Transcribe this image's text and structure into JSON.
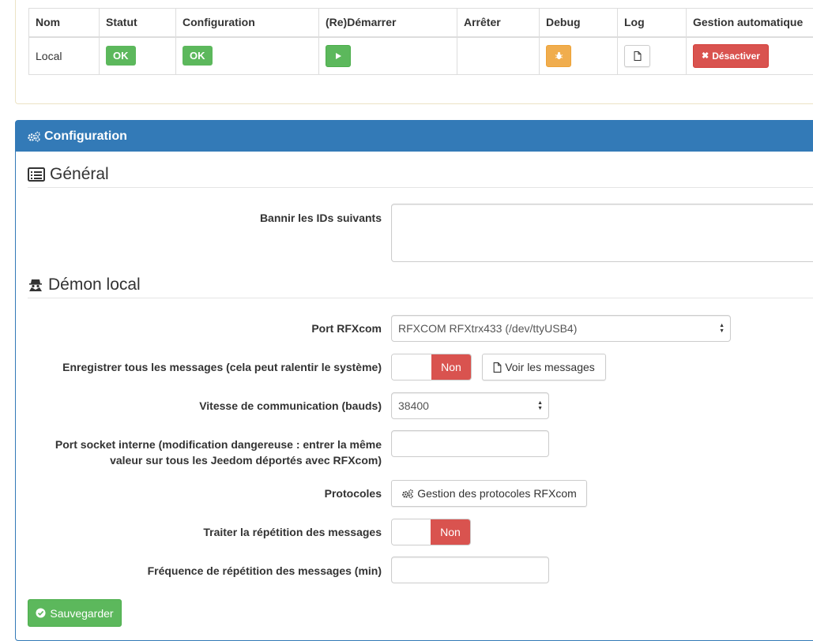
{
  "daemon_table": {
    "headers": [
      "Nom",
      "Statut",
      "Configuration",
      "(Re)Démarrer",
      "Arrêter",
      "Debug",
      "Log",
      "Gestion automatique"
    ],
    "row": {
      "name": "Local",
      "status": "OK",
      "configuration": "OK",
      "deactivate_label": "Désactiver"
    }
  },
  "config": {
    "heading": "Configuration",
    "general": {
      "title": "Général",
      "ban_ids_label": "Bannir les IDs suivants",
      "ban_ids_value": ""
    },
    "local_daemon": {
      "title": "Démon local",
      "port_label": "Port RFXcom",
      "port_value": "RFXCOM RFXtrx433 (/dev/ttyUSB4)",
      "log_all_label": "Enregistrer tous les messages (cela peut ralentir le système)",
      "log_all_toggle": "Non",
      "view_messages_label": "Voir les messages",
      "speed_label": "Vitesse de communication (bauds)",
      "speed_value": "38400",
      "socket_label_line1": "Port socket interne (modification dangereuse : entrer la même",
      "socket_label_line2": "valeur sur tous les Jeedom déportés avec RFXcom)",
      "socket_value": "",
      "protocols_label": "Protocoles",
      "protocols_button": "Gestion des protocoles RFXcom",
      "repeat_label": "Traiter la répétition des messages",
      "repeat_toggle": "Non",
      "freq_label": "Fréquence de répétition des messages (min)",
      "freq_value": ""
    },
    "save_button": "Sauvegarder"
  },
  "colors": {
    "primary": "#337ab7",
    "success": "#5cb85c",
    "warning": "#f0ad4e",
    "danger": "#d9534f"
  }
}
